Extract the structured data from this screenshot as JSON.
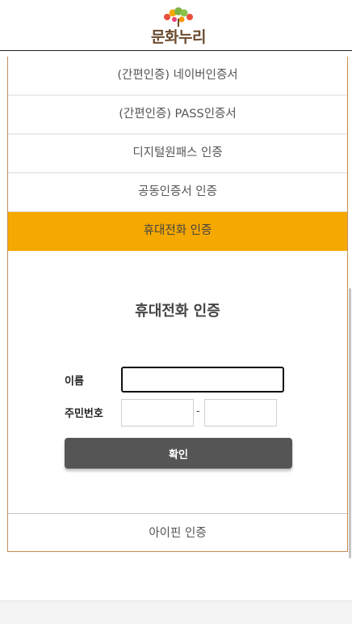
{
  "brand": {
    "logo_text": "문화누리",
    "accent_color": "#f5a800",
    "border_color": "#c98a52"
  },
  "auth_methods": [
    {
      "label": "(간편인증) 네이버인증서",
      "active": false
    },
    {
      "label": "(간편인증) PASS인증서",
      "active": false
    },
    {
      "label": "디지털원패스 인증",
      "active": false
    },
    {
      "label": "공동인증서 인증",
      "active": false
    },
    {
      "label": "휴대전화 인증",
      "active": true
    }
  ],
  "form": {
    "title": "휴대전화 인증",
    "name_label": "이름",
    "name_value": "",
    "rrn_label": "주민번호",
    "rrn_front_value": "",
    "rrn_back_value": "",
    "separator": "-",
    "confirm_label": "확인"
  },
  "ipin": {
    "label": "아이핀 인증"
  }
}
